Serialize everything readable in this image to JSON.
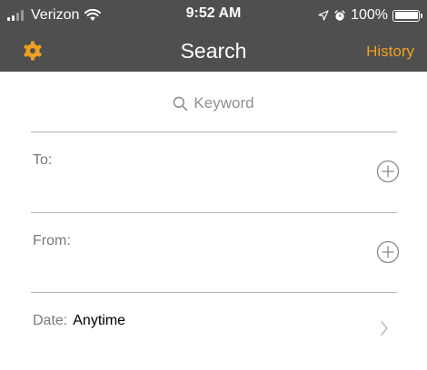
{
  "status_bar": {
    "carrier": "Verizon",
    "time": "9:52 AM",
    "battery": "100%",
    "battery_level": 1.0,
    "icons": [
      "signal-bars-icon",
      "wifi-icon",
      "location-arrow-icon",
      "alarm-icon",
      "battery-icon"
    ]
  },
  "nav": {
    "title": "Search",
    "history_label": "History",
    "settings_icon": "gear-icon",
    "accent_color": "#f0a020",
    "bar_color": "#4f4f4f"
  },
  "search": {
    "placeholder": "Keyword",
    "icon": "search-icon"
  },
  "fields": {
    "to_label": "To:",
    "from_label": "From:",
    "date_label": "Date:",
    "date_value": "Anytime",
    "add_icon": "plus-circle-icon",
    "chevron_icon": "chevron-right-icon"
  }
}
